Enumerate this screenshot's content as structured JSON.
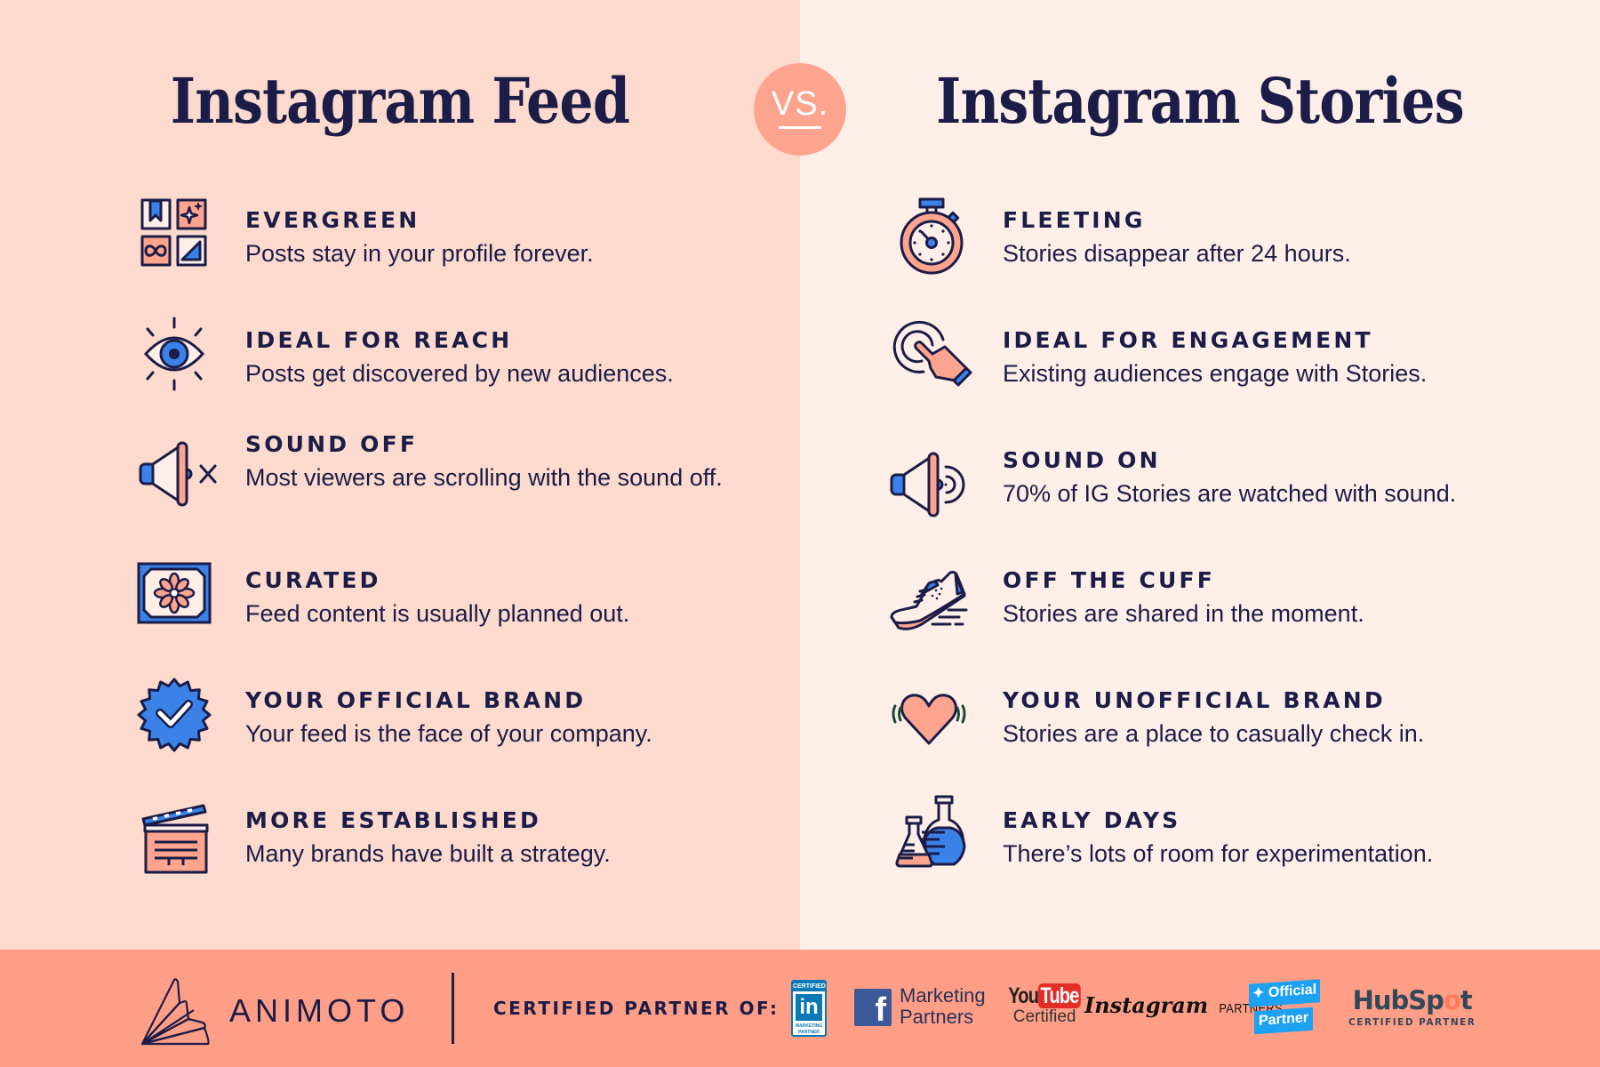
{
  "header": {
    "left_title": "Instagram Feed",
    "right_title": "Instagram Stories",
    "vs_label": "VS."
  },
  "colors": {
    "navy": "#1b1c47",
    "salmon": "#fca48e",
    "blue": "#3a82e8",
    "left_bg": "#fcdacd",
    "right_bg": "#feeee8",
    "footer_bg": "#ff9e86"
  },
  "feed": {
    "items": [
      {
        "icon": "evergreen-grid-icon",
        "title": "EVERGREEN",
        "description": "Posts stay in your profile forever."
      },
      {
        "icon": "eye-icon",
        "title": "IDEAL FOR REACH",
        "description": "Posts get discovered by new audiences."
      },
      {
        "icon": "speaker-muted-icon",
        "title": "SOUND OFF",
        "description": "Most viewers are scrolling with the sound off."
      },
      {
        "icon": "flower-tile-icon",
        "title": "CURATED",
        "description": "Feed content is usually planned out."
      },
      {
        "icon": "verified-badge-icon",
        "title": "YOUR OFFICIAL BRAND",
        "description": "Your feed is the face of your company."
      },
      {
        "icon": "clapperboard-icon",
        "title": "MORE ESTABLISHED",
        "description": "Many brands have built a strategy."
      }
    ]
  },
  "stories": {
    "items": [
      {
        "icon": "stopwatch-icon",
        "title": "FLEETING",
        "description": "Stories disappear after 24 hours."
      },
      {
        "icon": "tap-hand-icon",
        "title": "IDEAL FOR ENGAGEMENT",
        "description": "Existing audiences engage with Stories."
      },
      {
        "icon": "speaker-on-icon",
        "title": "SOUND ON",
        "description": "70% of IG Stories are watched with sound."
      },
      {
        "icon": "running-shoe-icon",
        "title": "OFF THE CUFF",
        "description": "Stories are shared in the moment."
      },
      {
        "icon": "heart-vibrate-icon",
        "title": "YOUR UNOFFICIAL BRAND",
        "description": "Stories are a place to casually check in."
      },
      {
        "icon": "lab-flasks-icon",
        "title": "EARLY DAYS",
        "description": "There’s lots of room for experimentation."
      }
    ]
  },
  "footer": {
    "brand": "ANIMOTO",
    "certified_label": "CERTIFIED PARTNER OF:",
    "partners": {
      "linkedin": {
        "top": "CERTIFIED",
        "mark": "in",
        "bottom1": "MARKETING",
        "bottom2": "PARTNER"
      },
      "facebook": {
        "mark": "f",
        "line1": "Marketing",
        "line2": "Partners"
      },
      "youtube": {
        "you": "You",
        "tube": "Tube",
        "sub": "Certified"
      },
      "instagram": {
        "mark": "Instagram",
        "sub": "PARTNERS"
      },
      "twitter": {
        "line1": "Official",
        "line2": "Partner"
      },
      "hubspot": {
        "mark_a": "HubSp",
        "mark_o": "o",
        "mark_b": "t",
        "sub": "CERTIFIED PARTNER"
      }
    }
  }
}
